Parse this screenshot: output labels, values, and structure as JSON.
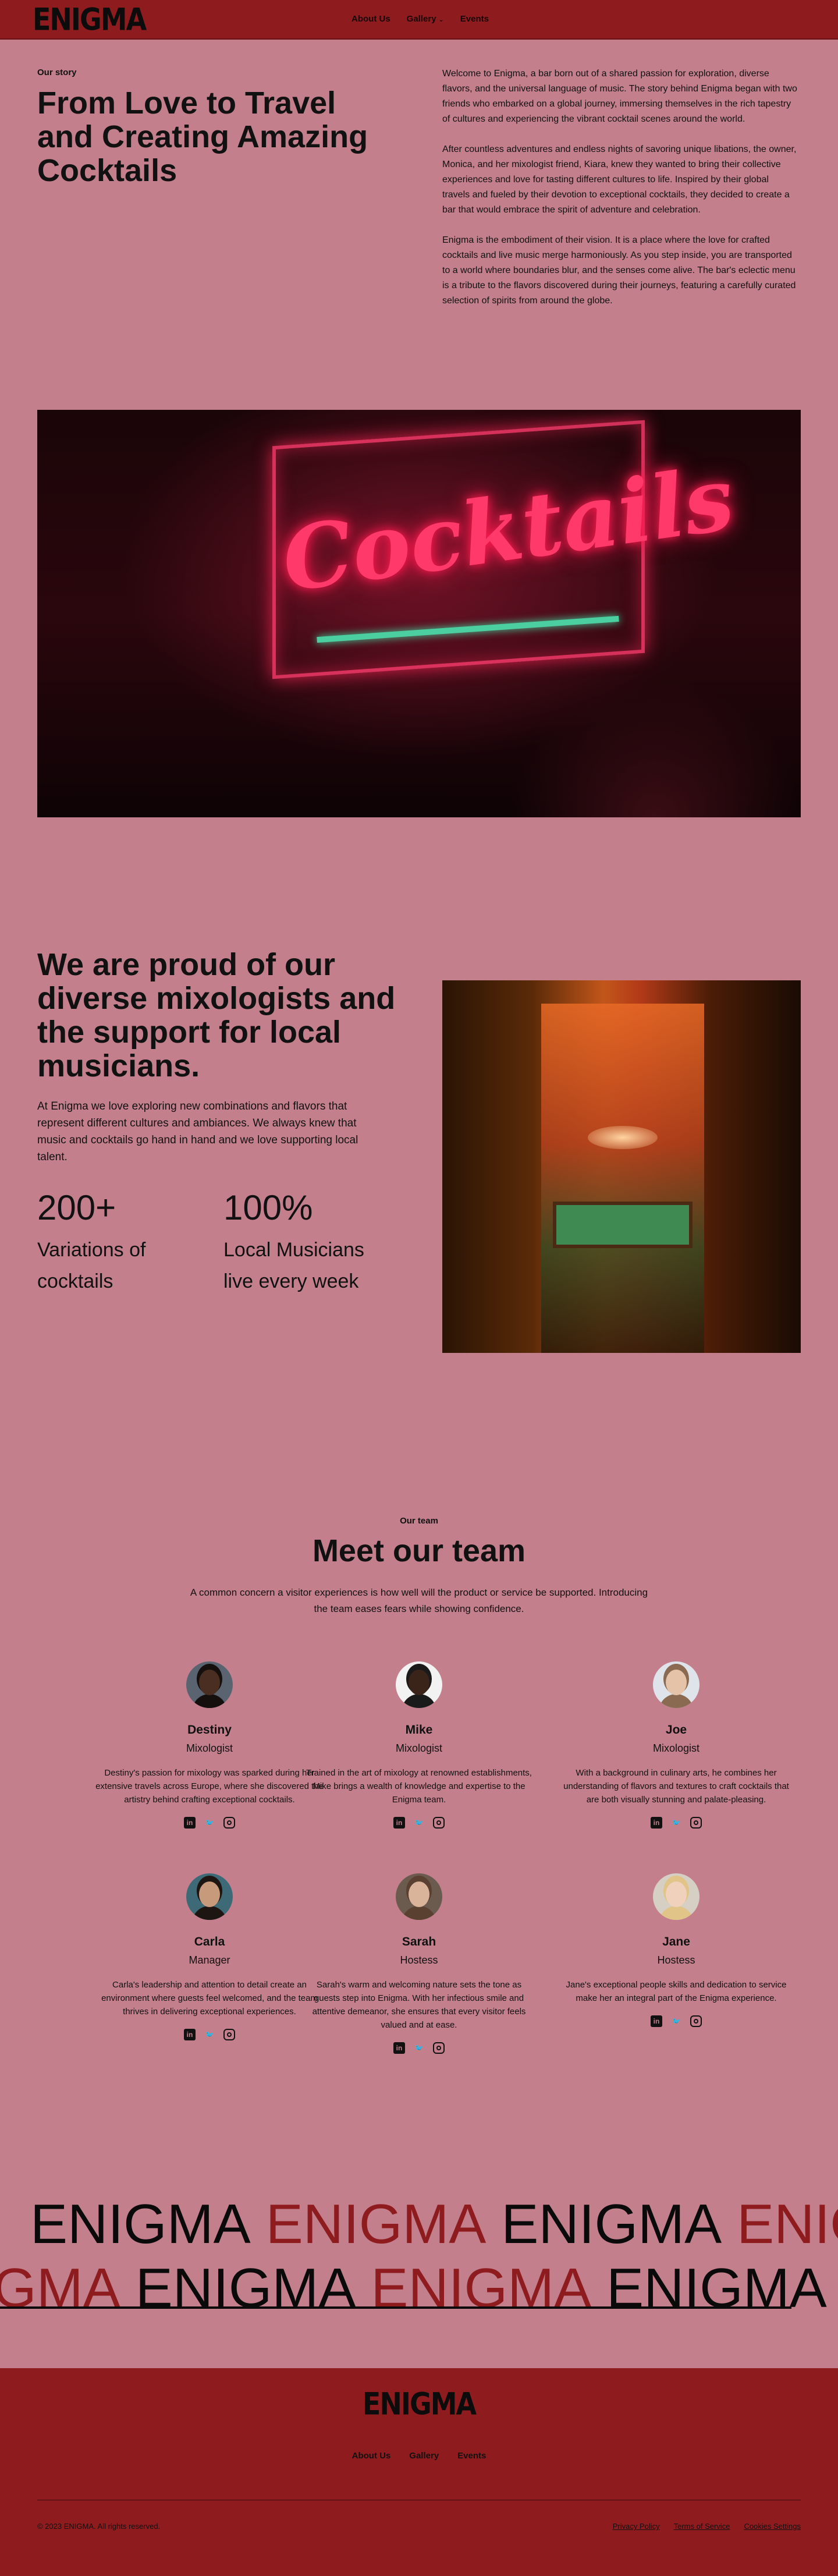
{
  "nav": {
    "logo": "ENIGMA",
    "links": [
      "About Us",
      "Gallery",
      "Events"
    ],
    "chevron": "⌄"
  },
  "story": {
    "eyebrow": "Our story",
    "title": "From Love to Travel and Creating Amazing Cocktails",
    "paragraphs": [
      "Welcome to Enigma, a bar born out of a shared passion for exploration, diverse flavors, and the universal language of music. The story behind Enigma began with two friends who embarked on a global journey, immersing themselves in the rich tapestry of cultures and experiencing the vibrant cocktail scenes around the world.",
      "After countless adventures and endless nights of savoring unique libations, the owner, Monica, and her mixologist friend, Kiara, knew they wanted to bring their collective experiences and love for tasting different cultures to life. Inspired by their global travels and fueled by their devotion to exceptional cocktails, they decided to create a bar that would embrace the spirit of adventure and celebration.",
      "Enigma is the embodiment of their vision. It is a place where the love for crafted cocktails and live music merge harmoniously. As you step inside, you are transported to a world where boundaries blur, and the senses come alive. The bar's eclectic menu is a tribute to the flavors discovered during their journeys, featuring a carefully curated selection of spirits from around the globe."
    ]
  },
  "photo1": {
    "neon_text": "Cocktails"
  },
  "proud": {
    "title": "We are proud of our diverse mixologists and the support for local musicians.",
    "text": "At Enigma we love exploring new combinations and flavors that represent different cultures and ambiances. We always knew that music and cocktails go hand in hand and we love supporting local talent.",
    "stats": [
      {
        "number": "200+",
        "label": "Variations of cocktails"
      },
      {
        "number": "100%",
        "label": "Local Musicians live every week"
      }
    ]
  },
  "team": {
    "eyebrow": "Our team",
    "title": "Meet our team",
    "description": "A common concern a visitor experiences is how well will the product or service be supported. Introducing the team eases fears while showing confidence.",
    "members": [
      {
        "name": "Destiny",
        "role": "Mixologist",
        "bio": "Destiny's passion for mixology was sparked during her extensive travels across Europe, where she discovered the artistry behind crafting exceptional cocktails.",
        "bg": "#5a6470",
        "skin": "#4a2e22",
        "hair": "#15100e"
      },
      {
        "name": "Mike",
        "role": "Mixologist",
        "bio": "Trained in the art of mixology at renowned establishments, Mike brings a wealth of knowledge and expertise to the Enigma team.",
        "bg": "#f2f2f2",
        "skin": "#3a2419",
        "hair": "#1a1a1a"
      },
      {
        "name": "Joe",
        "role": "Mixologist",
        "bio": "With a background in culinary arts, he combines her understanding of flavors and textures to craft cocktails that are both visually stunning and palate-pleasing.",
        "bg": "#dfe4ea",
        "skin": "#e5c3a8",
        "hair": "#8a6a50"
      },
      {
        "name": "Carla",
        "role": "Manager",
        "bio": "Carla's leadership and attention to detail create an environment where guests feel welcomed, and the team thrives in delivering exceptional experiences.",
        "bg": "#3e6a78",
        "skin": "#c89a7c",
        "hair": "#1c1512"
      },
      {
        "name": "Sarah",
        "role": "Hostess",
        "bio": "Sarah's warm and welcoming nature sets the tone as guests step into Enigma. With her infectious smile and attentive demeanor, she ensures that every visitor feels valued and at ease.",
        "bg": "#6b5a4e",
        "skin": "#d9b49a",
        "hair": "#5a4030"
      },
      {
        "name": "Jane",
        "role": "Hostess",
        "bio": "Jane's exceptional people skills and dedication to service make her an integral part of the Enigma experience.",
        "bg": "#d6cfc4",
        "skin": "#f0d2bc",
        "hair": "#e0c488"
      }
    ],
    "social_icons": [
      "linkedin-icon",
      "twitter-icon",
      "instagram-icon"
    ],
    "social_glyphs": {
      "in": "in",
      "tw": "🐦"
    }
  },
  "marquee": {
    "word": "ENIGMA",
    "row1_colors": [
      "#0a0a0a",
      "#8e1c1f",
      "#0a0a0a",
      "#8e1c1f",
      "#0a0a0a",
      "#8e1c1f"
    ],
    "row2_colors": [
      "#8e1c1f",
      "#0a0a0a",
      "#8e1c1f",
      "#0a0a0a",
      "#8e1c1f",
      "#0a0a0a"
    ]
  },
  "footer": {
    "logo": "ENIGMA",
    "links": [
      "About Us",
      "Gallery",
      "Events"
    ],
    "copyright": "© 2023 ENIGMA. All rights reserved.",
    "legal": [
      "Privacy Policy",
      "Terms of Service",
      "Cookies Settings"
    ]
  },
  "colors": {
    "background": "#c47f8c",
    "brand_red": "#8e1c1f",
    "text": "#111111"
  }
}
